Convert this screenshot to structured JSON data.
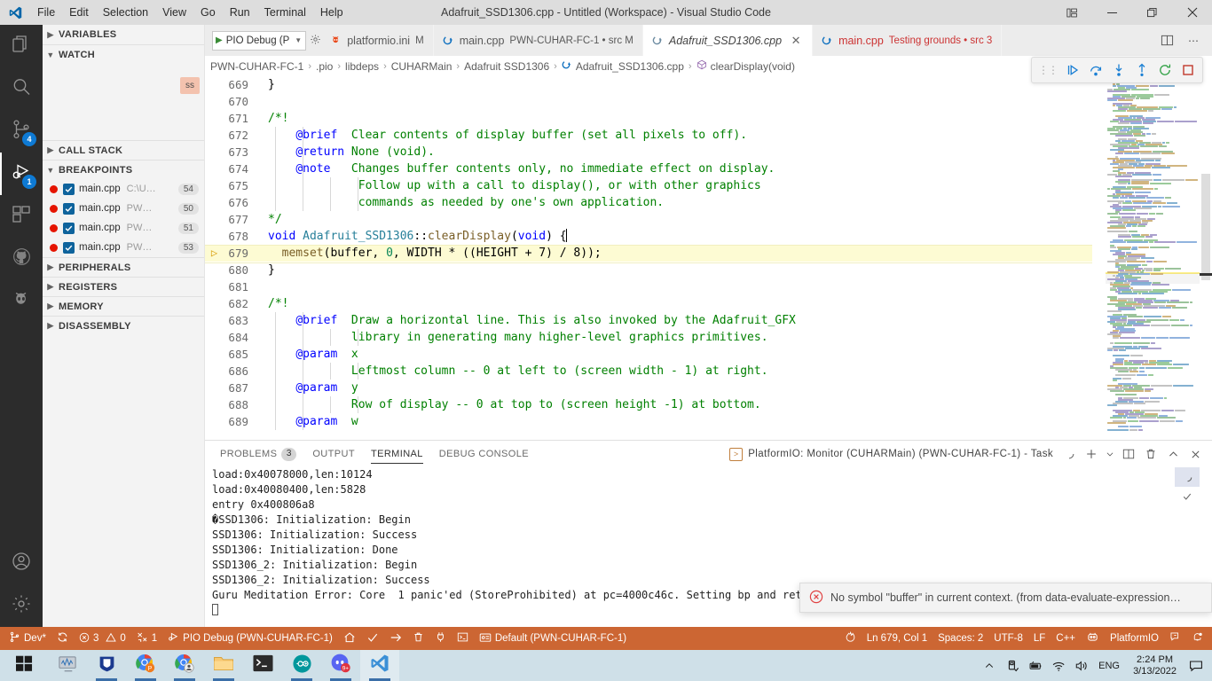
{
  "titlebar": {
    "title": "Adafruit_SSD1306.cpp - Untitled (Workspace) - Visual Studio Code",
    "menus": [
      "File",
      "Edit",
      "Selection",
      "View",
      "Go",
      "Run",
      "Terminal",
      "Help"
    ],
    "controls": [
      "layout-icon",
      "minimize",
      "restore",
      "close"
    ]
  },
  "activitybar": {
    "items": [
      {
        "name": "explorer",
        "icon": "files-icon",
        "badge": ""
      },
      {
        "name": "search",
        "icon": "search-icon",
        "badge": ""
      },
      {
        "name": "source-control",
        "icon": "source-control-icon",
        "badge": "4"
      },
      {
        "name": "run-and-debug",
        "icon": "run-debug-icon",
        "badge": "1"
      },
      {
        "name": "extensions",
        "icon": "extensions-icon",
        "badge": ""
      },
      {
        "name": "github",
        "icon": "github-icon",
        "badge": ""
      },
      {
        "name": "platformio",
        "icon": "platformio-alien-icon",
        "badge": ""
      }
    ],
    "bottom": [
      {
        "name": "accounts",
        "icon": "account-icon"
      },
      {
        "name": "settings",
        "icon": "gear-icon"
      }
    ]
  },
  "sidebar": {
    "sections": [
      {
        "label": "VARIABLES",
        "expanded": false
      },
      {
        "label": "WATCH",
        "expanded": true
      },
      {
        "label": "CALL STACK",
        "expanded": false
      },
      {
        "label": "BREAKPOINTS",
        "expanded": true
      },
      {
        "label": "PERIPHERALS",
        "expanded": false
      },
      {
        "label": "REGISTERS",
        "expanded": false
      },
      {
        "label": "MEMORY",
        "expanded": false
      },
      {
        "label": "DISASSEMBLY",
        "expanded": false
      }
    ],
    "watch_chip": "ss",
    "breakpoints": [
      {
        "file": "main.cpp",
        "path": "C:\\U…",
        "line": "54",
        "checked": true
      },
      {
        "file": "main.cpp",
        "path": "PW…",
        "line": "50",
        "checked": true
      },
      {
        "file": "main.cpp",
        "path": "PW…",
        "line": "51",
        "checked": true
      },
      {
        "file": "main.cpp",
        "path": "PW…",
        "line": "53",
        "checked": true
      }
    ]
  },
  "launch": {
    "config": "PIO Debug (P",
    "play_icon": "play-icon",
    "chevron": "chevron-down-icon",
    "gear_icon": "gear-icon"
  },
  "tabs": [
    {
      "label": "platformio.ini",
      "desc": "M",
      "icon": "platformio-icon",
      "active": false,
      "dirty": true
    },
    {
      "label": "main.cpp",
      "desc": "PWN-CUHAR-FC-1 • src M",
      "icon": "cpp-icon",
      "active": false,
      "dirty": true
    },
    {
      "label": "Adafruit_SSD1306.cpp",
      "desc": "",
      "icon": "cpp-icon",
      "active": true,
      "dirty": false
    },
    {
      "label": "main.cpp",
      "desc": "Testing grounds • src 3",
      "icon": "cpp-icon",
      "active": false,
      "dirty": false
    }
  ],
  "tab_actions": [
    {
      "name": "split-editor-button",
      "icon": "split-editor-icon"
    },
    {
      "name": "more-actions-button",
      "icon": "ellipsis-icon"
    }
  ],
  "breadcrumb": [
    {
      "label": "PWN-CUHAR-FC-1",
      "icon": ""
    },
    {
      "label": ".pio",
      "icon": ""
    },
    {
      "label": "libdeps",
      "icon": ""
    },
    {
      "label": "CUHARMain",
      "icon": ""
    },
    {
      "label": "Adafruit SSD1306",
      "icon": ""
    },
    {
      "label": "Adafruit_SSD1306.cpp",
      "icon": "cpp-icon"
    },
    {
      "label": "clearDisplay(void)",
      "icon": "method-icon"
    }
  ],
  "debug_toolbar": [
    {
      "name": "grip",
      "icon": "grip-icon"
    },
    {
      "name": "continue-button",
      "icon": "continue-icon"
    },
    {
      "name": "step-over-button",
      "icon": "step-over-icon"
    },
    {
      "name": "step-into-button",
      "icon": "step-into-icon"
    },
    {
      "name": "step-out-button",
      "icon": "step-out-icon"
    },
    {
      "name": "restart-button",
      "icon": "restart-icon"
    },
    {
      "name": "stop-button",
      "icon": "stop-icon"
    }
  ],
  "editor": {
    "first_line": 669,
    "lines": [
      {
        "n": 669,
        "bp": false,
        "hl": false,
        "indents": 0,
        "tokens": [
          {
            "t": "}",
            "c": "pln"
          }
        ]
      },
      {
        "n": 670,
        "bp": false,
        "hl": false,
        "indents": 0,
        "tokens": []
      },
      {
        "n": 671,
        "bp": false,
        "hl": false,
        "indents": 0,
        "tokens": [
          {
            "t": "/*!",
            "c": "cmt"
          }
        ]
      },
      {
        "n": 672,
        "bp": false,
        "hl": false,
        "indents": 2,
        "tokens": [
          {
            "t": "    ",
            "c": "pln"
          },
          {
            "t": "@brief",
            "c": "doc"
          },
          {
            "t": "  Clear contents of display buffer (set all pixels to off).",
            "c": "cmt"
          }
        ]
      },
      {
        "n": 673,
        "bp": false,
        "hl": false,
        "indents": 2,
        "tokens": [
          {
            "t": "    ",
            "c": "pln"
          },
          {
            "t": "@return",
            "c": "doc"
          },
          {
            "t": " None (void).",
            "c": "cmt"
          }
        ]
      },
      {
        "n": 674,
        "bp": false,
        "hl": false,
        "indents": 2,
        "tokens": [
          {
            "t": "    ",
            "c": "pln"
          },
          {
            "t": "@note",
            "c": "doc"
          },
          {
            "t": "   Changes buffer contents only, no immediate effect on display.",
            "c": "cmt"
          }
        ]
      },
      {
        "n": 675,
        "bp": false,
        "hl": false,
        "indents": 4,
        "tokens": [
          {
            "t": "             Follow up with a call to display(), or with other graphics",
            "c": "cmt"
          }
        ]
      },
      {
        "n": 676,
        "bp": false,
        "hl": false,
        "indents": 4,
        "tokens": [
          {
            "t": "             commands as needed by one's own application.",
            "c": "cmt"
          }
        ]
      },
      {
        "n": 677,
        "bp": false,
        "hl": false,
        "indents": 0,
        "tokens": [
          {
            "t": "*/",
            "c": "cmt"
          }
        ]
      },
      {
        "n": 678,
        "bp": false,
        "hl": false,
        "indents": 0,
        "tokens": [
          {
            "t": "void",
            "c": "kw"
          },
          {
            "t": " Adafruit_SSD1306",
            "c": "cls"
          },
          {
            "t": "::",
            "c": "pln"
          },
          {
            "t": "clearDisplay",
            "c": "fn"
          },
          {
            "t": "(",
            "c": "pln"
          },
          {
            "t": "void",
            "c": "kw"
          },
          {
            "t": ") {",
            "c": "pln"
          }
        ]
      },
      {
        "n": 679,
        "bp": true,
        "hl": true,
        "indents": 0,
        "tokens": [
          {
            "t": "  ",
            "c": "pln"
          },
          {
            "t": "memset",
            "c": "fn"
          },
          {
            "t": "(buffer, ",
            "c": "pln"
          },
          {
            "t": "0",
            "c": "num"
          },
          {
            "t": ", WIDTH * ((HEIGHT + ",
            "c": "pln"
          },
          {
            "t": "7",
            "c": "pln"
          },
          {
            "t": ") / ",
            "c": "pln"
          },
          {
            "t": "8",
            "c": "pln"
          },
          {
            "t": "));",
            "c": "pln"
          }
        ]
      },
      {
        "n": 680,
        "bp": false,
        "hl": false,
        "indents": 0,
        "tokens": [
          {
            "t": "}",
            "c": "pln"
          }
        ]
      },
      {
        "n": 681,
        "bp": false,
        "hl": false,
        "indents": 0,
        "tokens": []
      },
      {
        "n": 682,
        "bp": false,
        "hl": false,
        "indents": 0,
        "tokens": [
          {
            "t": "/*!",
            "c": "cmt"
          }
        ]
      },
      {
        "n": 683,
        "bp": false,
        "hl": false,
        "indents": 2,
        "tokens": [
          {
            "t": "    ",
            "c": "pln"
          },
          {
            "t": "@brief",
            "c": "doc"
          },
          {
            "t": "  Draw a horizontal line. This is also invoked by the Adafruit_GFX",
            "c": "cmt"
          }
        ]
      },
      {
        "n": 684,
        "bp": false,
        "hl": false,
        "indents": 4,
        "tokens": [
          {
            "t": "            library in generating many higher-level graphics primitives.",
            "c": "cmt"
          }
        ]
      },
      {
        "n": 685,
        "bp": false,
        "hl": false,
        "indents": 2,
        "tokens": [
          {
            "t": "    ",
            "c": "pln"
          },
          {
            "t": "@param",
            "c": "doc"
          },
          {
            "t": "  x",
            "c": "cmt"
          }
        ]
      },
      {
        "n": 686,
        "bp": false,
        "hl": false,
        "indents": 4,
        "tokens": [
          {
            "t": "            Leftmost column -- 0 at left to (screen width - 1) at right.",
            "c": "cmt"
          }
        ]
      },
      {
        "n": 687,
        "bp": false,
        "hl": false,
        "indents": 2,
        "tokens": [
          {
            "t": "    ",
            "c": "pln"
          },
          {
            "t": "@param",
            "c": "doc"
          },
          {
            "t": "  y",
            "c": "cmt"
          }
        ]
      },
      {
        "n": 688,
        "bp": false,
        "hl": false,
        "indents": 4,
        "tokens": [
          {
            "t": "            Row of display -- 0 at top to (screen height -1) at bottom.",
            "c": "cmt"
          }
        ]
      },
      {
        "n": 689,
        "bp": false,
        "hl": false,
        "indents": 2,
        "tokens": [
          {
            "t": "    ",
            "c": "pln"
          },
          {
            "t": "@param",
            "c": "doc"
          },
          {
            "t": "  w",
            "c": "cmt"
          }
        ]
      }
    ]
  },
  "panel": {
    "tabs": [
      {
        "label": "PROBLEMS",
        "badge": "3",
        "active": false
      },
      {
        "label": "OUTPUT",
        "badge": "",
        "active": false
      },
      {
        "label": "TERMINAL",
        "badge": "",
        "active": true
      },
      {
        "label": "DEBUG CONSOLE",
        "badge": "",
        "active": false
      }
    ],
    "terminal_selector": "PlatformIO: Monitor (CUHARMain) (PWN-CUHAR-FC-1) - Task",
    "actions": [
      {
        "name": "terminal-spinner",
        "icon": "spinner-icon"
      },
      {
        "name": "new-terminal-button",
        "icon": "plus-icon"
      },
      {
        "name": "terminal-dropdown-button",
        "icon": "chevron-down-icon"
      },
      {
        "name": "split-terminal-button",
        "icon": "split-icon"
      },
      {
        "name": "kill-terminal-button",
        "icon": "trash-icon"
      },
      {
        "name": "maximize-panel-button",
        "icon": "chevron-up-icon"
      },
      {
        "name": "close-panel-button",
        "icon": "close-icon"
      }
    ],
    "terminal_lines": [
      "load:0x40078000,len:10124",
      "load:0x40080400,len:5828",
      "entry 0x400806a8",
      "�SSD1306: Initialization: Begin",
      "SSD1306: Initialization: Success",
      "SSD1306: Initialization: Done",
      "SSD1306_2: Initialization: Begin",
      "SSD1306_2: Initialization: Success",
      "Guru Meditation Error: Core  1 panic'ed (StoreProhibited) at pc=4000c46c. Setting bp and return"
    ]
  },
  "toast": {
    "icon": "error-circle-icon",
    "message": "No symbol \"buffer\" in current context. (from data-evaluate-expression…"
  },
  "statusbar": {
    "background": "#cc6633",
    "left": [
      {
        "name": "branch",
        "icon": "source-control-icon",
        "text": "Dev*"
      },
      {
        "name": "sync",
        "icon": "sync-icon",
        "text": ""
      },
      {
        "name": "problems",
        "icon": "error-icon",
        "text": "3",
        "icon2": "warning-icon",
        "text2": "0"
      },
      {
        "name": "ports",
        "icon": "ports-icon",
        "text": "1"
      },
      {
        "name": "debug-config",
        "icon": "debug-alt-icon",
        "text": "PIO Debug (PWN-CUHAR-FC-1)"
      },
      {
        "name": "pio-home",
        "icon": "home-icon",
        "text": ""
      },
      {
        "name": "pio-build",
        "icon": "check-icon",
        "text": ""
      },
      {
        "name": "pio-upload",
        "icon": "arrow-right-icon",
        "text": ""
      },
      {
        "name": "pio-clean",
        "icon": "trash-icon",
        "text": ""
      },
      {
        "name": "pio-serial-monitor",
        "icon": "plug-icon",
        "text": ""
      },
      {
        "name": "pio-new-terminal",
        "icon": "terminal-icon",
        "text": ""
      },
      {
        "name": "pio-project-env",
        "icon": "folder-env-icon",
        "text": "Default (PWN-CUHAR-FC-1)"
      }
    ],
    "right": [
      {
        "name": "platformio-flame",
        "icon": "flame-icon",
        "text": ""
      },
      {
        "name": "cursor-position",
        "text": "Ln 679, Col 1"
      },
      {
        "name": "indentation",
        "text": "Spaces: 2"
      },
      {
        "name": "encoding",
        "text": "UTF-8"
      },
      {
        "name": "eol",
        "text": "LF"
      },
      {
        "name": "language-mode",
        "text": "C++"
      },
      {
        "name": "live-share",
        "icon": "live-share-icon",
        "text": ""
      },
      {
        "name": "platformio-status",
        "text": "PlatformIO"
      },
      {
        "name": "feedback",
        "icon": "feedback-icon",
        "text": ""
      },
      {
        "name": "notifications",
        "icon": "bell-dot-icon",
        "text": ""
      }
    ]
  },
  "taskbar": {
    "items": [
      {
        "name": "start-button",
        "icon": "windows-icon",
        "running": false
      },
      {
        "name": "task-manager",
        "icon": "monitor-icon",
        "running": false
      },
      {
        "name": "security-app",
        "icon": "shield-icon",
        "running": true
      },
      {
        "name": "chrome-profile-p",
        "icon": "chrome-icon",
        "running": true
      },
      {
        "name": "chrome-profile-user",
        "icon": "chrome-icon",
        "running": true
      },
      {
        "name": "file-explorer",
        "icon": "folder-icon",
        "running": false
      },
      {
        "name": "terminal-app",
        "icon": "terminal-icon",
        "running": false
      },
      {
        "name": "arduino-ide",
        "icon": "arduino-icon",
        "running": true
      },
      {
        "name": "discord",
        "icon": "discord-icon",
        "running": true,
        "badge": "9+"
      },
      {
        "name": "vscode",
        "icon": "vscode-icon",
        "running": true,
        "active": true
      }
    ],
    "tray": [
      {
        "name": "show-hidden-icons",
        "icon": "chevron-up-icon"
      },
      {
        "name": "removable-media",
        "icon": "usb-icon"
      },
      {
        "name": "battery",
        "icon": "battery-icon"
      },
      {
        "name": "network",
        "icon": "wifi-icon"
      },
      {
        "name": "volume",
        "icon": "speaker-icon"
      },
      {
        "name": "language",
        "icon": "",
        "text": "ENG"
      }
    ],
    "clock_time": "2:24 PM",
    "clock_date": "3/13/2022",
    "action_center": "notification-icon"
  }
}
